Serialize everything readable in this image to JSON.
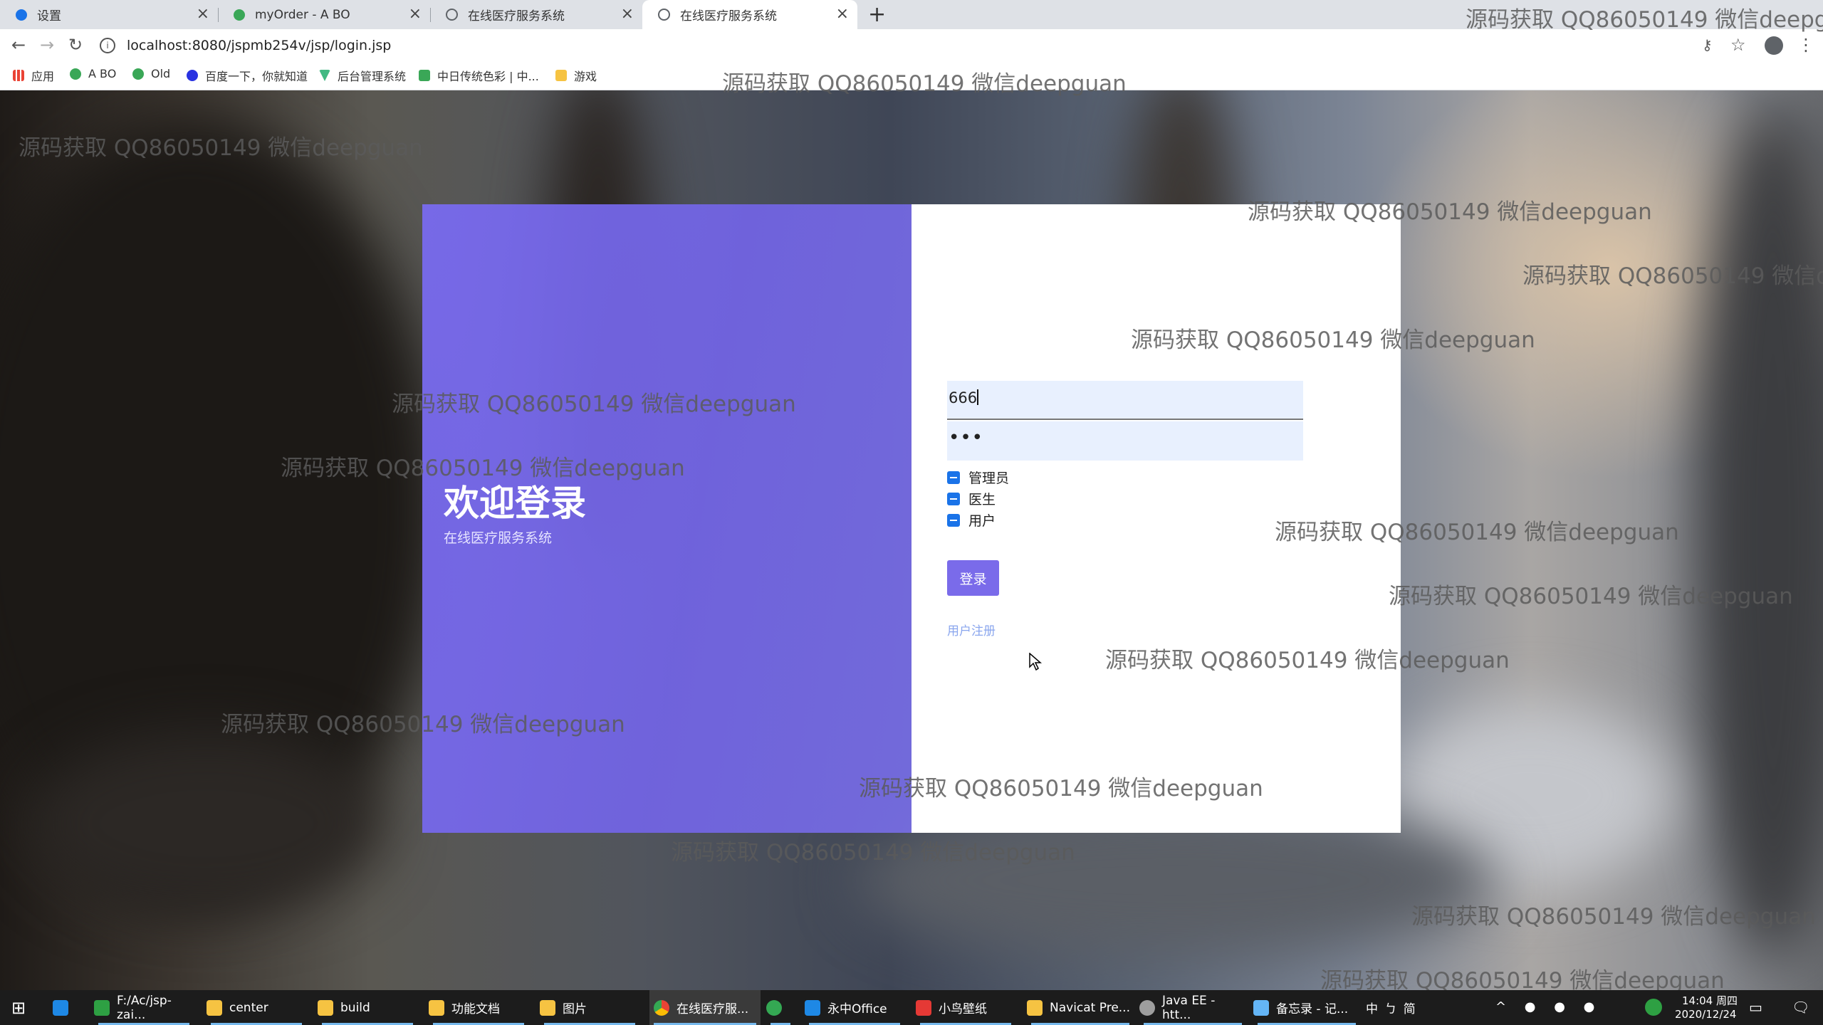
{
  "browser": {
    "tabs": [
      {
        "title": "设置",
        "color": "#1a73e8"
      },
      {
        "title": "myOrder - A BO",
        "color": "#3aa757"
      },
      {
        "title": "在线医疗服务系统",
        "color": "#5f6368"
      },
      {
        "title": "在线医疗服务系统",
        "color": "#5f6368",
        "active": true
      }
    ],
    "new_tab": "+",
    "url": "localhost:8080/jspmb254v/jsp/login.jsp",
    "bookmarks": [
      {
        "label": "应用",
        "color": "#ea4335"
      },
      {
        "label": "A BO",
        "color": "#3aa757"
      },
      {
        "label": "Old",
        "color": "#3aa757"
      },
      {
        "label": "百度一下，你就知道",
        "color": "#2932e1"
      },
      {
        "label": "后台管理系统",
        "color": "#42b983"
      },
      {
        "label": "中日传统色彩 | 中...",
        "color": "#3aa757"
      },
      {
        "label": "游戏",
        "color": "#f6c342"
      }
    ]
  },
  "login": {
    "welcome_title": "欢迎登录",
    "welcome_subtitle": "在线医疗服务系统",
    "username_value": "666",
    "password_value": "•••",
    "roles": [
      {
        "label": "管理员",
        "checked": true
      },
      {
        "label": "医生",
        "checked": true
      },
      {
        "label": "用户",
        "checked": true
      }
    ],
    "login_button": "登录",
    "register_link": "用户注册"
  },
  "watermark": "源码获取 QQ86050149 微信deepguan",
  "taskbar": {
    "items": [
      {
        "label": "F:/Ac/jsp-zai...",
        "color": "#2ea043"
      },
      {
        "label": "center",
        "color": "#f6c342"
      },
      {
        "label": "build",
        "color": "#f6c342"
      },
      {
        "label": "功能文档",
        "color": "#f6c342"
      },
      {
        "label": "图片",
        "color": "#f6c342"
      },
      {
        "label": "在线医疗服...",
        "color": "#ea4335",
        "active": true
      },
      {
        "label": "",
        "color": "#34a853"
      },
      {
        "label": "永中Office",
        "color": "#1e88e5"
      },
      {
        "label": "小鸟壁纸",
        "color": "#e53935"
      },
      {
        "label": "Navicat Pre...",
        "color": "#f6c342"
      },
      {
        "label": "Java EE - htt...",
        "color": "#9e9e9e"
      },
      {
        "label": "备忘录 - 记...",
        "color": "#64b5f6"
      }
    ],
    "tray_text": "中 ㄅ 简",
    "time": "14:04 周四",
    "date": "2020/12/24"
  }
}
